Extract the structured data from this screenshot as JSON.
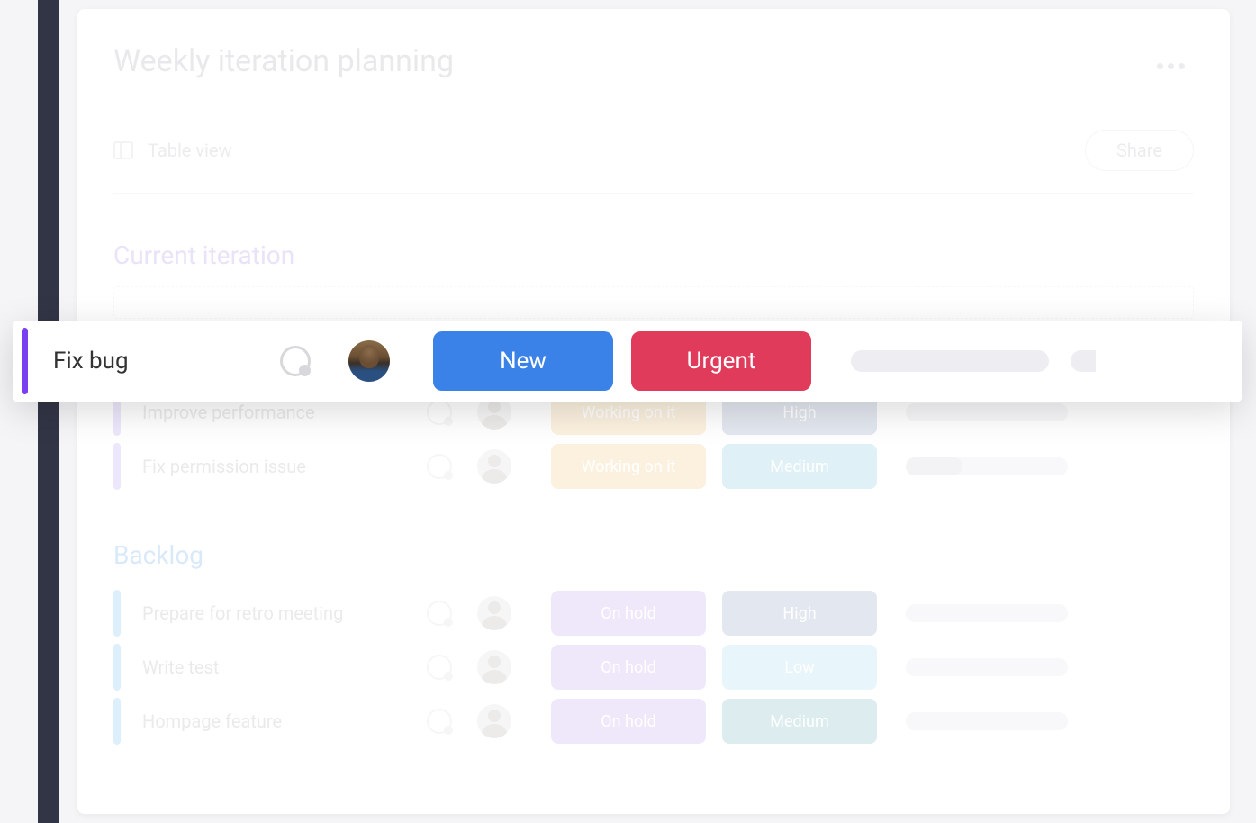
{
  "board": {
    "title": "Weekly iteration planning",
    "view_label": "Table view",
    "share_label": "Share"
  },
  "highlighted_row": {
    "title": "Fix bug",
    "status": "New",
    "priority": "Urgent"
  },
  "sections": [
    {
      "name": "Current iteration",
      "color": "purple",
      "rows": [
        {
          "title": "Improve performance",
          "status": "Working on it",
          "status_color": "orange",
          "priority": "High",
          "priority_color": "grayblue",
          "progress": "full"
        },
        {
          "title": "Fix permission issue",
          "status": "Working on it",
          "status_color": "orange",
          "priority": "Medium",
          "priority_color": "lightblue",
          "progress": "partial"
        }
      ]
    },
    {
      "name": "Backlog",
      "color": "blue",
      "rows": [
        {
          "title": "Prepare for retro meeting",
          "status": "On hold",
          "status_color": "purple",
          "priority": "High",
          "priority_color": "grayblue",
          "progress": "full"
        },
        {
          "title": "Write test",
          "status": "On hold",
          "status_color": "purple",
          "priority": "Low",
          "priority_color": "cyan",
          "progress": "full"
        },
        {
          "title": "Hompage feature",
          "status": "On hold",
          "status_color": "purple",
          "priority": "Medium",
          "priority_color": "teal",
          "progress": "full"
        }
      ]
    }
  ]
}
